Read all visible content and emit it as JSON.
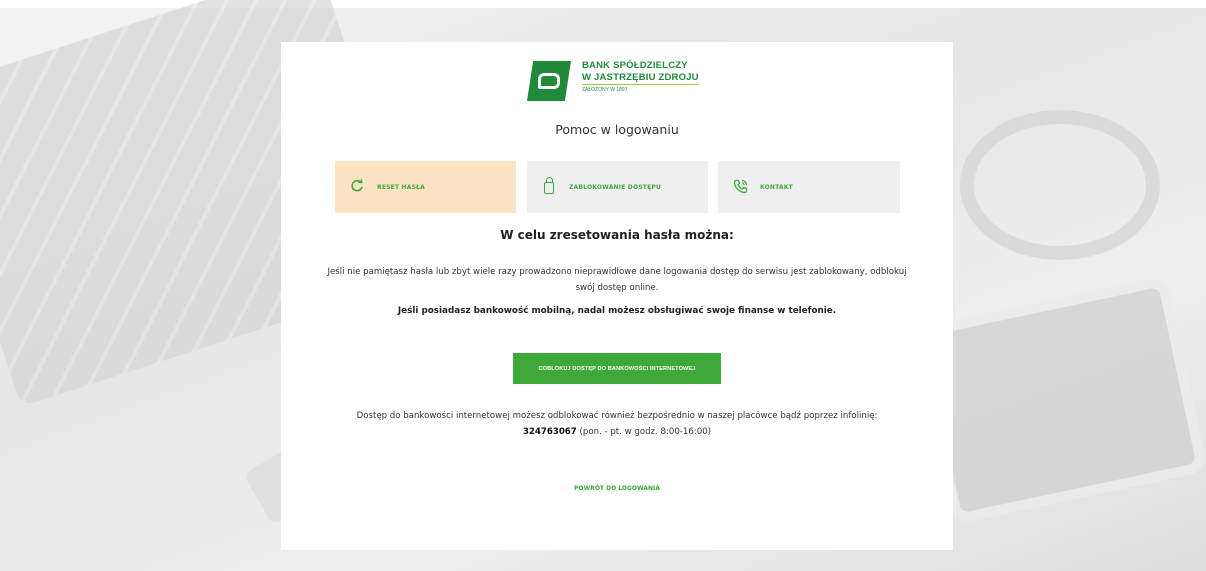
{
  "brand": {
    "line1": "BANK SPÓŁDZIELCZY",
    "line2": "W JASTRZĘBIU ZDROJU",
    "line3": "ZAŁOŻONY W 1897",
    "color": "#1f8a3a"
  },
  "page_title": "Pomoc w logowaniu",
  "tabs": [
    {
      "label": "RESET HASŁA",
      "icon": "refresh-icon",
      "active": true
    },
    {
      "label": "ZABLOKOWANIE DOSTĘPU",
      "icon": "lock-icon",
      "active": false
    },
    {
      "label": "KONTAKT",
      "icon": "phone-icon",
      "active": false
    }
  ],
  "content": {
    "heading": "W celu zresetowania hasła można:",
    "paragraph": "Jeśli nie pamiętasz hasła lub zbyt wiele razy prowadzono nieprawidłowe dane logowania dostęp do serwisu jest zablokowany, odblokuj swój dostęp online.",
    "bold_paragraph": "Jeśli posiadasz bankowość mobilną, nadal możesz obsługiwać swoje finanse w telefonie.",
    "unlock_button": "ODBLOKUJ DOSTĘP DO BANKOWOŚCI INTERNETOWEJ",
    "info_prefix": "Dostęp do bankowości internetowej możesz odblokować również bezpośrednio w naszej placówce bądź poprzez infolinię: ",
    "info_phone": "324763067",
    "info_suffix": " (pon. - pt. w godz. 8:00-16:00)",
    "back_link": "POWRÓT DO LOGOWANIA"
  },
  "colors": {
    "accent": "#3fa83b",
    "active_tab": "#fce3c3",
    "tab_bg": "#efefef"
  }
}
